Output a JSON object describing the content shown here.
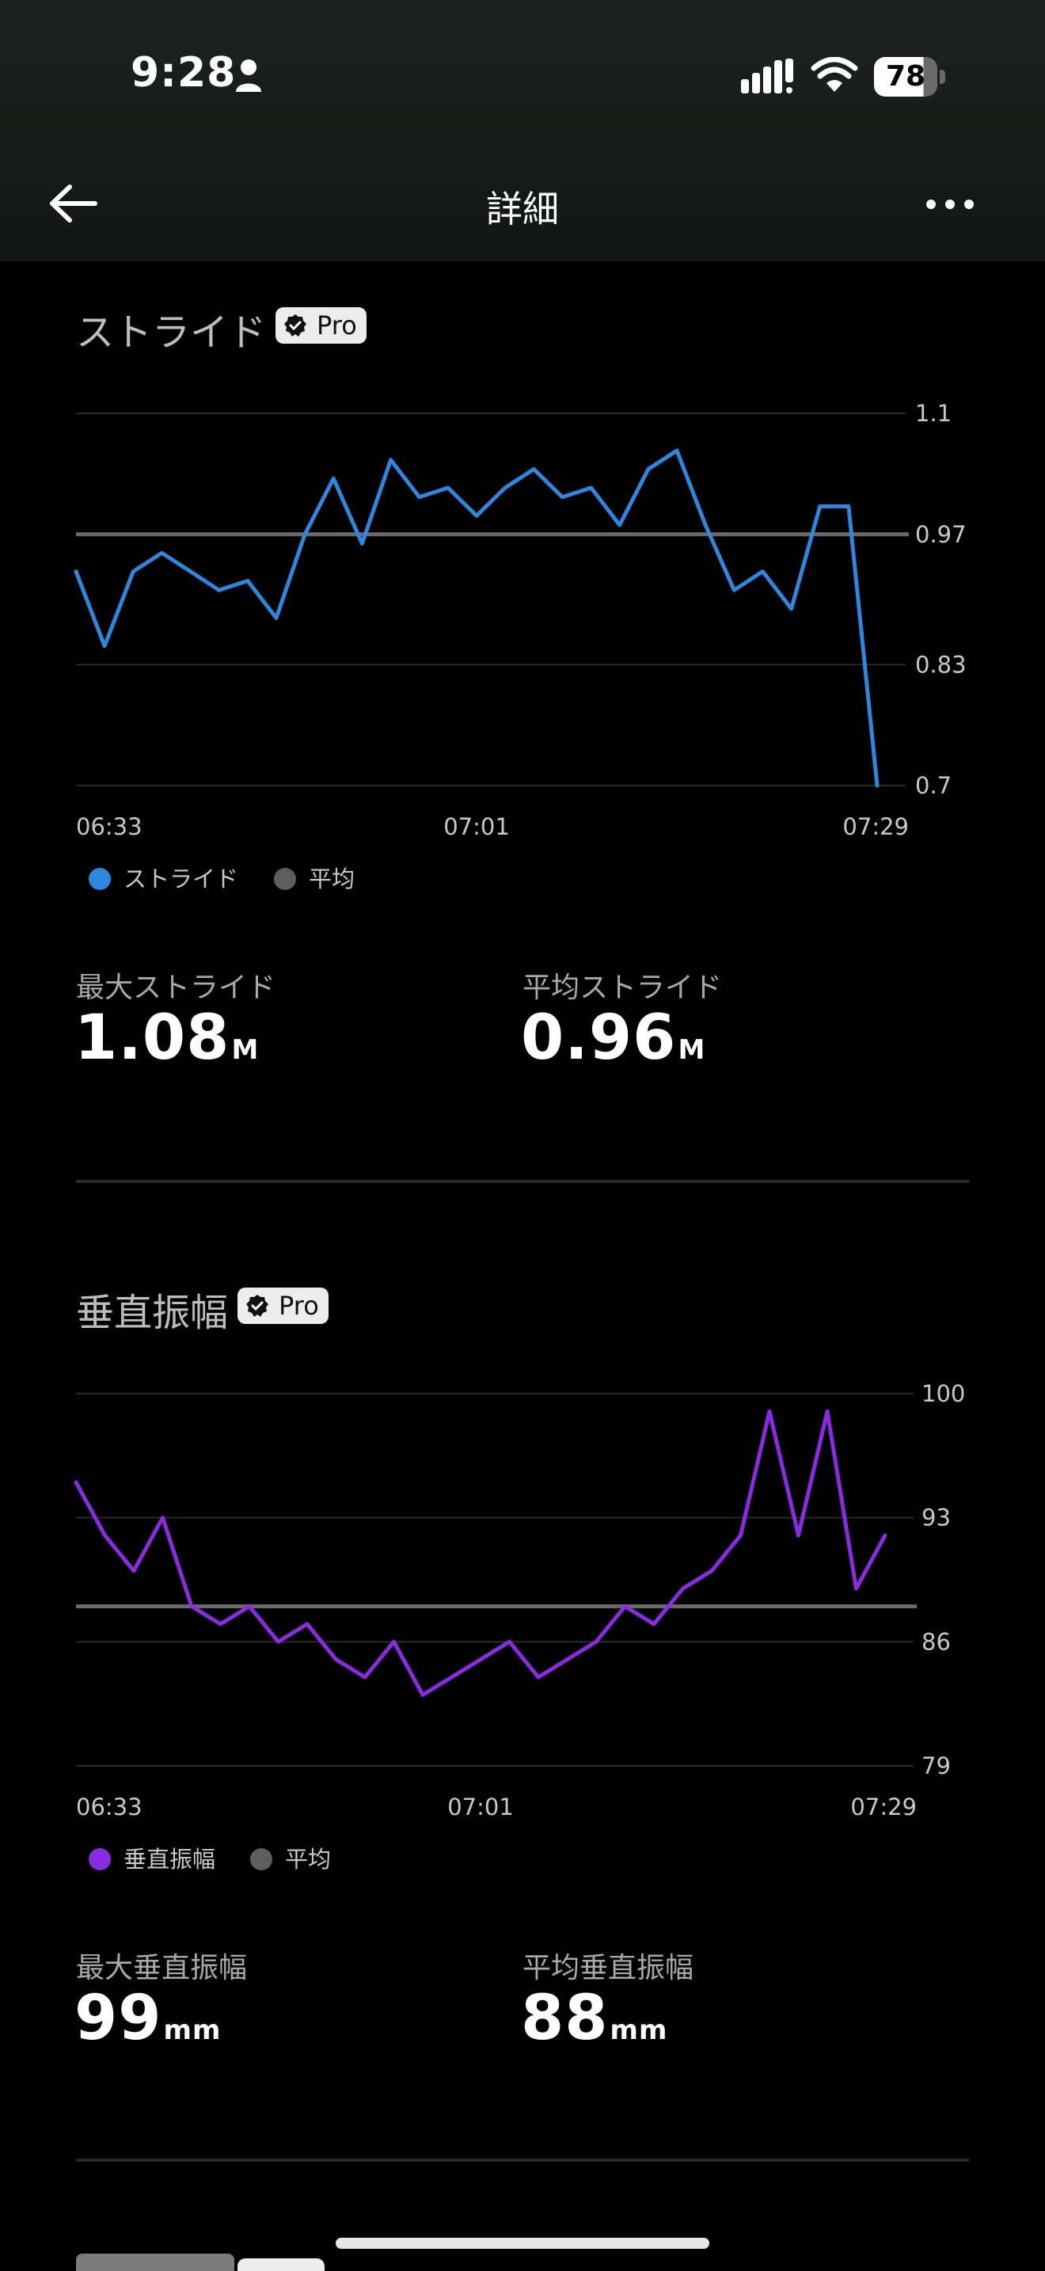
{
  "status_bar": {
    "time": "9:28",
    "battery": "78"
  },
  "nav": {
    "title": "詳細"
  },
  "stride": {
    "title": "ストライド",
    "badge": "Pro",
    "legend_series": "ストライド",
    "legend_avg": "平均",
    "max_label": "最大ストライド",
    "max_value": "1.08",
    "max_unit": "M",
    "avg_label": "平均ストライド",
    "avg_value": "0.96",
    "avg_unit": "M"
  },
  "vertical": {
    "title": "垂直振幅",
    "badge": "Pro",
    "legend_series": "垂直振幅",
    "legend_avg": "平均",
    "max_label": "最大垂直振幅",
    "max_value": "99",
    "max_unit": "mm",
    "avg_label": "平均垂直振幅",
    "avg_value": "88",
    "avg_unit": "mm"
  },
  "colors": {
    "stride": "#2f86de",
    "vertical": "#8a2be2",
    "average": "#6a6a6a",
    "grid": "#2b2b2b"
  },
  "chart_data": [
    {
      "type": "line",
      "series": [
        {
          "name": "ストライド",
          "x": [
            "06:33",
            "06:35",
            "06:37",
            "06:39",
            "06:41",
            "06:43",
            "06:45",
            "06:47",
            "06:49",
            "06:51",
            "06:53",
            "06:55",
            "06:57",
            "06:59",
            "07:01",
            "07:03",
            "07:05",
            "07:07",
            "07:09",
            "07:11",
            "07:13",
            "07:15",
            "07:17",
            "07:19",
            "07:21",
            "07:23",
            "07:25",
            "07:27",
            "07:29"
          ],
          "values": [
            0.93,
            0.85,
            0.93,
            0.95,
            0.93,
            0.91,
            0.92,
            0.88,
            0.97,
            1.03,
            0.96,
            1.05,
            1.01,
            1.02,
            0.99,
            1.02,
            1.04,
            1.01,
            1.02,
            0.98,
            1.04,
            1.06,
            0.98,
            0.91,
            0.93,
            0.89,
            1.0,
            1.0,
            0.7
          ]
        }
      ],
      "average": 0.97,
      "y_ticks": [
        "0.7",
        "0.83",
        "0.97",
        "1.1"
      ],
      "ylim": [
        0.7,
        1.1
      ],
      "x_ticks": [
        "06:33",
        "07:01",
        "07:29"
      ],
      "grid": true
    },
    {
      "type": "line",
      "series": [
        {
          "name": "垂直振幅",
          "x": [
            "06:33",
            "06:35",
            "06:37",
            "06:39",
            "06:41",
            "06:43",
            "06:45",
            "06:47",
            "06:49",
            "06:51",
            "06:53",
            "06:55",
            "06:57",
            "06:59",
            "07:01",
            "07:03",
            "07:05",
            "07:07",
            "07:09",
            "07:11",
            "07:13",
            "07:15",
            "07:17",
            "07:19",
            "07:21",
            "07:23",
            "07:25",
            "07:27",
            "07:29"
          ],
          "values": [
            95,
            92,
            90,
            93,
            88,
            87,
            88,
            86,
            87,
            85,
            84,
            86,
            83,
            84,
            85,
            86,
            84,
            85,
            86,
            88,
            87,
            89,
            90,
            92,
            99,
            92,
            99,
            89,
            92
          ]
        }
      ],
      "average": 88,
      "y_ticks": [
        "79",
        "86",
        "93",
        "100"
      ],
      "ylim": [
        79,
        100
      ],
      "x_ticks": [
        "06:33",
        "07:01",
        "07:29"
      ],
      "grid": true
    }
  ]
}
